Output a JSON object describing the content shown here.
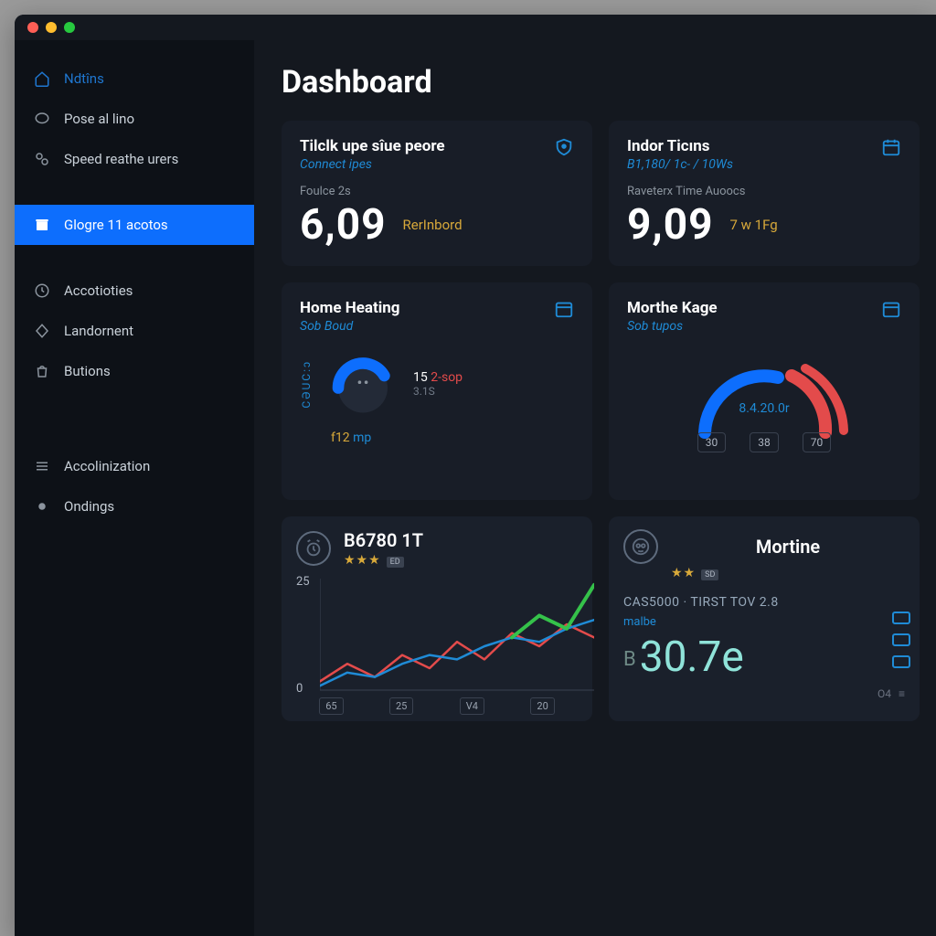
{
  "colors": {
    "accent": "#0d6efd",
    "link": "#1f8bd6",
    "warn": "#d8a93a",
    "danger": "#e34b4b",
    "teal": "#8fe3d9"
  },
  "page": {
    "title": "Dashboard"
  },
  "sidebar": {
    "items": [
      {
        "label": "Ndtîns",
        "icon": "home-icon",
        "accent": true
      },
      {
        "label": "Pose al lino",
        "icon": "chat-icon"
      },
      {
        "label": "Speed reathe urers",
        "icon": "link-icon"
      },
      {
        "label": "Glogre 11 acotos",
        "icon": "archive-icon",
        "active": true
      },
      {
        "label": "Accotioties",
        "icon": "clock-icon"
      },
      {
        "label": "Landornent",
        "icon": "diamond-icon"
      },
      {
        "label": "Butions",
        "icon": "bag-icon"
      },
      {
        "label": "Accolinization",
        "icon": "menu-icon"
      },
      {
        "label": "Ondings",
        "icon": "dot-icon"
      }
    ]
  },
  "cards": {
    "c1": {
      "title": "Tilclk upe sîue peore",
      "subtitle": "Connect ipes",
      "small": "Foulce 2s",
      "value": "6,09",
      "tag": "RerInbord",
      "icon": "shield-icon"
    },
    "c2": {
      "title": "Indor Ticıns",
      "subtitle": "B1,180/ 1c- / 10Ws",
      "small": "Raveterx Time Auoocs",
      "value": "9,09",
      "tag": "7 w 1Fg",
      "icon": "calendar-icon"
    },
    "c3": {
      "title": "Home Heating",
      "subtitle": "Sob Boud",
      "vlabel": "CƏUC:ɔ",
      "g_row1a": "15",
      "g_row1b": "2-sop",
      "g_row2": "3.1S",
      "foot_a": "f12",
      "foot_b": "mp",
      "icon": "calendar-icon"
    },
    "c4": {
      "title": "Morthe Kage",
      "subtitle": "Sob tupos",
      "center": "8.4.20.0r",
      "chips": [
        "30",
        "38",
        "70"
      ],
      "icon": "calendar-icon"
    },
    "c5": {
      "title": "B6780 1T",
      "stars": "★★★",
      "badge": "ED",
      "icon": "alarm-icon"
    },
    "c6": {
      "title": "Mortine",
      "stars": "★★",
      "badge": "SD",
      "line1": "CAS5000 · TIRST TOV 2.8",
      "line2": "malbe",
      "prefix": "B",
      "value": "30.7e",
      "foot": [
        "O4",
        "≡"
      ],
      "icon": "owl-icon"
    }
  },
  "chart_data": {
    "type": "line",
    "title": "B6780 1T",
    "ylabel": "",
    "ylim": [
      0,
      25
    ],
    "yticks": [
      0,
      25
    ],
    "xticks": [
      "65",
      "25",
      "V4",
      "20"
    ],
    "series": [
      {
        "name": "red",
        "color": "#e34b4b",
        "values": [
          2,
          6,
          3,
          8,
          5,
          11,
          7,
          13,
          10,
          15,
          12
        ]
      },
      {
        "name": "blue",
        "color": "#1f8bd6",
        "values": [
          1,
          4,
          3,
          6,
          8,
          7,
          10,
          12,
          11,
          14,
          16
        ]
      },
      {
        "name": "green",
        "color": "#35c24a",
        "values": [
          null,
          null,
          null,
          null,
          null,
          null,
          null,
          12,
          17,
          14,
          24
        ]
      }
    ]
  }
}
